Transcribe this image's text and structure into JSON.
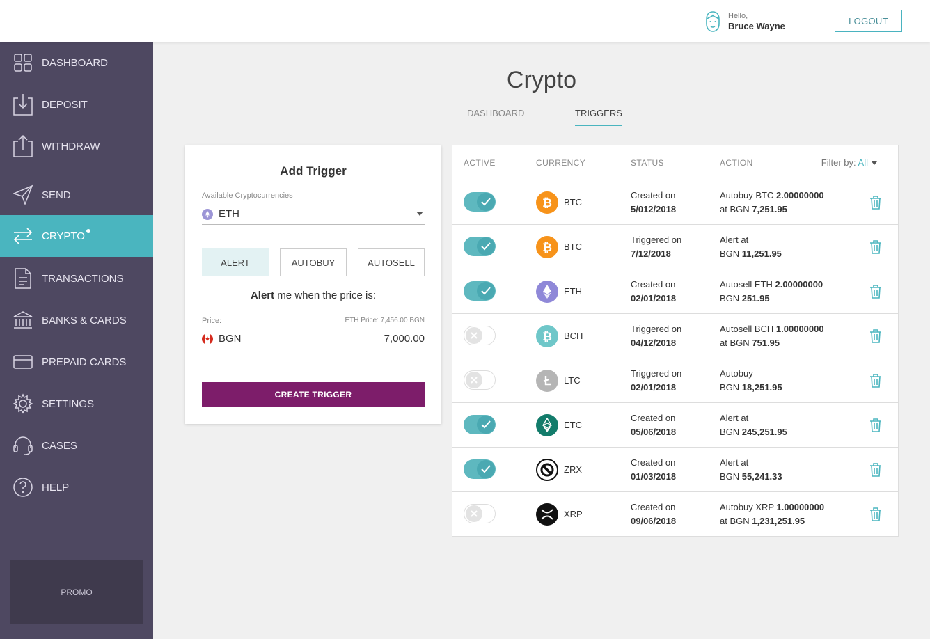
{
  "header": {
    "greeting": "Hello,",
    "user_name": "Bruce Wayne",
    "logout_label": "LOGOUT"
  },
  "sidebar": {
    "items": [
      {
        "label": "DASHBOARD",
        "icon": "dashboard-icon"
      },
      {
        "label": "DEPOSIT",
        "icon": "deposit-icon"
      },
      {
        "label": "WITHDRAW",
        "icon": "withdraw-icon"
      },
      {
        "label": "SEND",
        "icon": "send-icon"
      },
      {
        "label": "CRYPTO",
        "icon": "crypto-icon",
        "active": true
      },
      {
        "label": "TRANSACTIONS",
        "icon": "transactions-icon"
      },
      {
        "label": "BANKS & CARDS",
        "icon": "bank-icon"
      },
      {
        "label": "PREPAID CARDS",
        "icon": "card-icon"
      },
      {
        "label": "SETTINGS",
        "icon": "gear-icon"
      },
      {
        "label": "CASES",
        "icon": "headset-icon"
      },
      {
        "label": "HELP",
        "icon": "help-icon"
      }
    ],
    "promo": "PROMO"
  },
  "page": {
    "title": "Crypto",
    "tabs": [
      {
        "label": "DASHBOARD",
        "active": false
      },
      {
        "label": "TRIGGERS",
        "active": true
      }
    ]
  },
  "add_trigger": {
    "title": "Add Trigger",
    "crypto_label": "Available Cryptocurrencies",
    "crypto_value": "ETH",
    "types": [
      "ALERT",
      "AUTOBUY",
      "AUTOSELL"
    ],
    "selected_type": "ALERT",
    "alert_bold": "Alert",
    "alert_rest": " me when the price is:",
    "price_label": "Price:",
    "eth_price": "ETH Price: 7,456.00 BGN",
    "currency": "BGN",
    "amount": "7,000.00",
    "create_label": "CREATE TRIGGER"
  },
  "triggers": {
    "columns": [
      "ACTIVE",
      "CURRENCY",
      "STATUS",
      "ACTION"
    ],
    "filter_label": "Filter by: ",
    "filter_value": "All",
    "rows": [
      {
        "active": true,
        "code": "BTC",
        "status1": "Created on",
        "status2": "5/012/2018",
        "action1": "Autobuy BTC ",
        "action1b": "2.00000000",
        "action2": "at BGN ",
        "action2b": "7,251.95"
      },
      {
        "active": true,
        "code": "BTC",
        "status1": "Triggered on",
        "status2": "7/12/2018",
        "action1": "Alert at",
        "action1b": "",
        "action2": "BGN ",
        "action2b": "11,251.95"
      },
      {
        "active": true,
        "code": "ETH",
        "status1": "Created on",
        "status2": "02/01/2018",
        "action1": "Autosell ETH ",
        "action1b": "2.00000000",
        "action2": "BGN ",
        "action2b": "251.95"
      },
      {
        "active": false,
        "code": "BCH",
        "status1": "Triggered on",
        "status2": "04/12/2018",
        "action1": "Autosell BCH ",
        "action1b": "1.00000000",
        "action2": "at BGN ",
        "action2b": "751.95"
      },
      {
        "active": false,
        "code": "LTC",
        "status1": "Triggered on",
        "status2": "02/01/2018",
        "action1": "Autobuy",
        "action1b": "",
        "action2": "BGN ",
        "action2b": "18,251.95"
      },
      {
        "active": true,
        "code": "ETC",
        "status1": "Created on",
        "status2": "05/06/2018",
        "action1": "Alert at",
        "action1b": "",
        "action2": "BGN ",
        "action2b": "245,251.95"
      },
      {
        "active": true,
        "code": "ZRX",
        "status1": "Created on",
        "status2": "01/03/2018",
        "action1": "Alert at",
        "action1b": "",
        "action2": "BGN ",
        "action2b": "55,241.33"
      },
      {
        "active": false,
        "code": "XRP",
        "status1": "Created on",
        "status2": "09/06/2018",
        "action1": "Autobuy XRP ",
        "action1b": "1.00000000",
        "action2": "at BGN ",
        "action2b": "1,231,251.95"
      }
    ]
  },
  "colors": {
    "sidebar_bg": "#4e4861",
    "accent_teal": "#4ab5bf",
    "create_button": "#7d1d6a"
  }
}
